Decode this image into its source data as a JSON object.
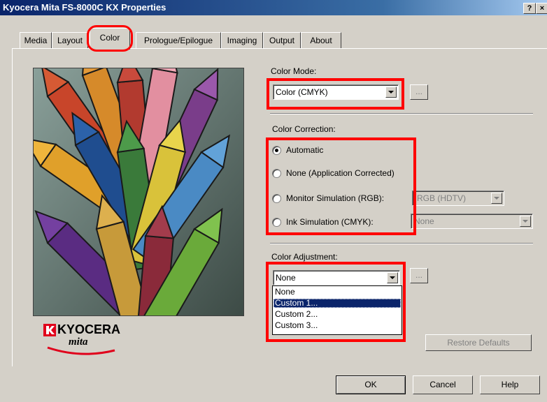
{
  "window": {
    "title": "Kyocera Mita FS-8000C KX Properties",
    "help_glyph": "?",
    "close_glyph": "×"
  },
  "tabs": [
    {
      "label": "Media"
    },
    {
      "label": "Layout"
    },
    {
      "label": "Color"
    },
    {
      "label": "Prologue/Epilogue"
    },
    {
      "label": "Imaging"
    },
    {
      "label": "Output"
    },
    {
      "label": "About"
    }
  ],
  "color_mode": {
    "label": "Color Mode:",
    "value": "Color (CMYK)",
    "more_button": "..."
  },
  "color_correction": {
    "label": "Color Correction:",
    "options": [
      {
        "label": "Automatic",
        "checked": true
      },
      {
        "label": "None (Application Corrected)",
        "checked": false
      },
      {
        "label": "Monitor Simulation (RGB):",
        "checked": false
      },
      {
        "label": "Ink Simulation (CMYK):",
        "checked": false
      }
    ],
    "monitor_value": "RGB (HDTV)",
    "ink_value": "None"
  },
  "color_adjustment": {
    "label": "Color Adjustment:",
    "value": "None",
    "more_button": "...",
    "options": [
      "None",
      "Custom 1...",
      "Custom 2...",
      "Custom 3..."
    ],
    "selected_index": 1
  },
  "logo": {
    "brand": "KYOCERA",
    "sub": "mita"
  },
  "buttons": {
    "restore_defaults": "Restore Defaults",
    "ok": "OK",
    "cancel": "Cancel",
    "help": "Help"
  },
  "colors": {
    "titlebar": "#0a246a",
    "face": "#d4d0c8",
    "highlight_annotation": "#ff0000",
    "kyocera_red": "#e0001b"
  }
}
